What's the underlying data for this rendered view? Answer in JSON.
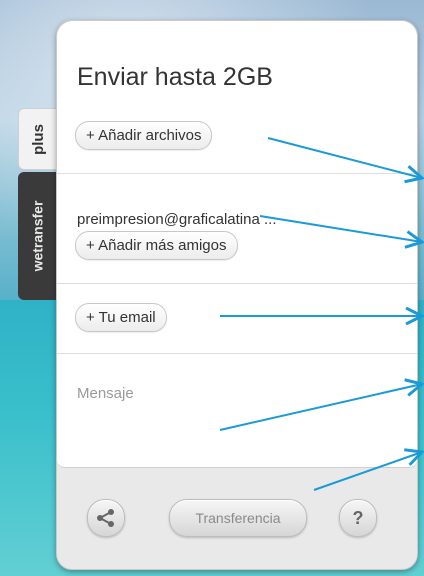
{
  "sidebar": {
    "tab_plus": "plus",
    "tab_wetransfer": "wetransfer"
  },
  "form": {
    "title": "Enviar hasta 2GB",
    "add_files_label": "+ Añadir archivos",
    "recipient_email": "preimpresion@graficalatina ...",
    "add_friends_label": "+ Añadir más amigos",
    "your_email_label": "+ Tu email",
    "message_placeholder": "Mensaje"
  },
  "footer": {
    "share_icon": "share-icon",
    "transfer_label": "Transferencia",
    "help_label": "?"
  },
  "colors": {
    "annotation_arrow": "#1a9ad6"
  }
}
